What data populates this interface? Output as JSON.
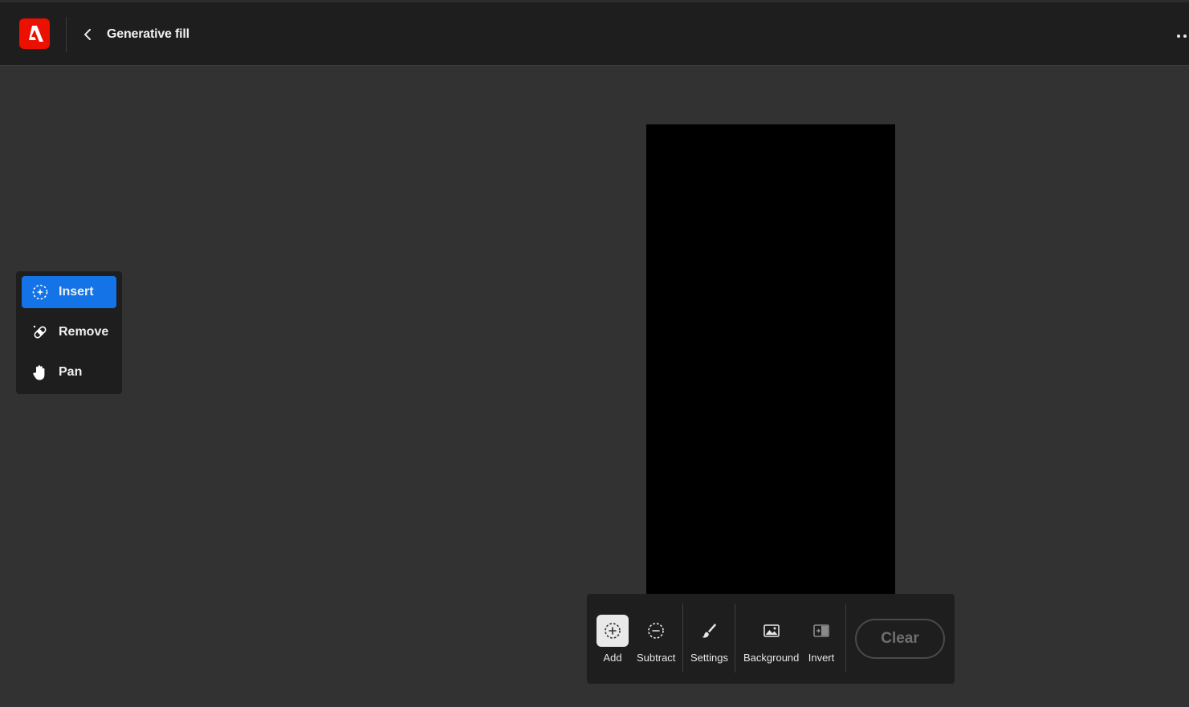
{
  "header": {
    "title": "Generative fill",
    "logo_icon": "adobe-logo-icon",
    "back_icon": "chevron-left-icon",
    "more_icon": "more-icon"
  },
  "tools_panel": {
    "items": [
      {
        "label": "Insert",
        "icon": "sparkle-circle-icon",
        "active": true
      },
      {
        "label": "Remove",
        "icon": "bandage-icon",
        "active": false
      },
      {
        "label": "Pan",
        "icon": "hand-icon",
        "active": false
      }
    ]
  },
  "toolbar": {
    "add_label": "Add",
    "subtract_label": "Subtract",
    "settings_label": "Settings",
    "background_label": "Background",
    "invert_label": "Invert",
    "clear_label": "Clear"
  },
  "colors": {
    "accent": "#1473e6",
    "brand": "#eb1000",
    "header_bg": "#1e1e1e",
    "workspace_bg": "#323232"
  }
}
